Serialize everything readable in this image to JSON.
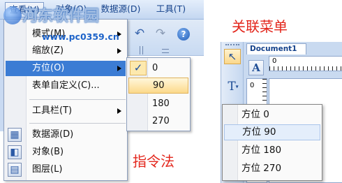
{
  "watermark": {
    "site_name": "河东软件园",
    "url": "www.pc0359.cn"
  },
  "menubar": {
    "view": "查看(V)",
    "object": "对象(O)",
    "datasource": "数据源(D)",
    "tools": "工具(T)"
  },
  "toolbar": {
    "icons": [
      "undo-icon",
      "redo-icon",
      "help-icon"
    ]
  },
  "view_menu": {
    "items": [
      {
        "label": "模式(M)",
        "submenu": true
      },
      {
        "label": "缩放(Z)",
        "submenu": true
      },
      {
        "label": "方位(O)",
        "submenu": true,
        "highlighted": true
      },
      {
        "label": "表单自定义(C)...",
        "submenu": false
      },
      {
        "label": "工具栏(T)",
        "submenu": true
      },
      {
        "label": "数据源(D)",
        "submenu": false,
        "icon": "datasource-icon"
      },
      {
        "label": "对象(B)",
        "submenu": false,
        "icon": "object-icon"
      },
      {
        "label": "图层(L)",
        "submenu": false,
        "icon": "layer-icon"
      }
    ]
  },
  "orientation_submenu": {
    "items": [
      "0",
      "90",
      "180",
      "270"
    ],
    "checked_index": 0,
    "highlighted_index": 1
  },
  "captions": {
    "command_method": "指令法",
    "context_menu": "关联菜单"
  },
  "document": {
    "tab": "Document1",
    "ruler_top_zero": "0",
    "ruler_left_zero": "0",
    "tool_icons": [
      "pointer-icon",
      "text-box-icon",
      "text-tool-icon"
    ]
  },
  "context_menu": {
    "items": [
      "方位 0",
      "方位 90",
      "方位 180",
      "方位 270"
    ],
    "highlighted_index": 1
  },
  "colors": {
    "menu_highlight": "#3b7cd4",
    "hover_orange": "#fcd98a",
    "caption_red": "#e3261c",
    "context_highlight": "#e4eefb"
  }
}
